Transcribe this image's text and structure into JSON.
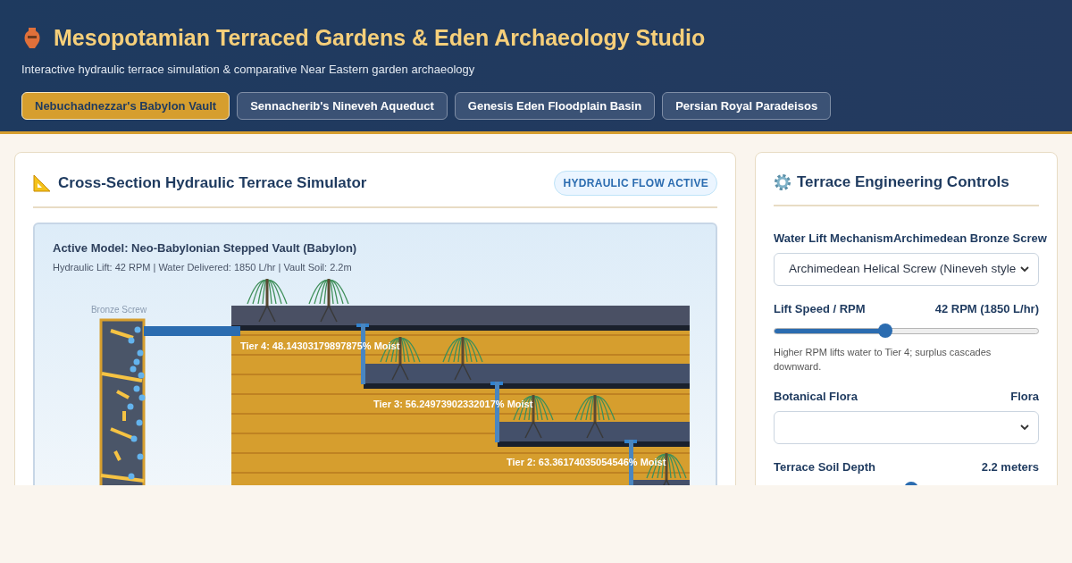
{
  "header": {
    "title": "Mesopotamian Terraced Gardens & Eden Archaeology Studio",
    "subtitle": "Interactive hydraulic terrace simulation & comparative Near Eastern garden archaeology"
  },
  "tabs": [
    {
      "label": "Nebuchadnezzar's Babylon Vault",
      "selected": true
    },
    {
      "label": "Sennacherib's Nineveh Aqueduct",
      "selected": false
    },
    {
      "label": "Genesis Eden Floodplain Basin",
      "selected": false
    },
    {
      "label": "Persian Royal Paradeisos",
      "selected": false
    }
  ],
  "simulator": {
    "title": "Cross-Section Hydraulic Terrace Simulator",
    "badge": "HYDRAULIC FLOW ACTIVE",
    "model_title": "Active Model: Neo-Babylonian Stepped Vault (Babylon)",
    "model_stats": "Hydraulic Lift: 42 RPM | Water Delivered: 1850 L/hr | Vault Soil: 2.2m",
    "screw_label": "Bronze Screw",
    "tiers": [
      {
        "label": "Tier 4: 48.14303179897875% Moist"
      },
      {
        "label": "Tier 3: 56.24973902332017% Moist"
      },
      {
        "label": "Tier 2: 63.36174035054546% Moist"
      }
    ]
  },
  "controls": {
    "title": "Terrace Engineering Controls",
    "fields": [
      {
        "kind": "select",
        "label": "Water Lift Mechanism",
        "reading": "Archimedean Bronze Screw",
        "value": "Archimedean Helical Screw (Nineveh style"
      },
      {
        "kind": "slider",
        "label": "Lift Speed / RPM",
        "reading": "42 RPM (1850 L/hr)",
        "level": 0.42,
        "hint": "Higher RPM lifts water to Tier 4; surplus cascades downward."
      },
      {
        "kind": "select",
        "label": "Botanical Flora",
        "reading": "Flora"
      },
      {
        "kind": "slider",
        "label": "Terrace Soil Depth",
        "reading": "2.2 meters",
        "level": 0.52
      }
    ]
  }
}
